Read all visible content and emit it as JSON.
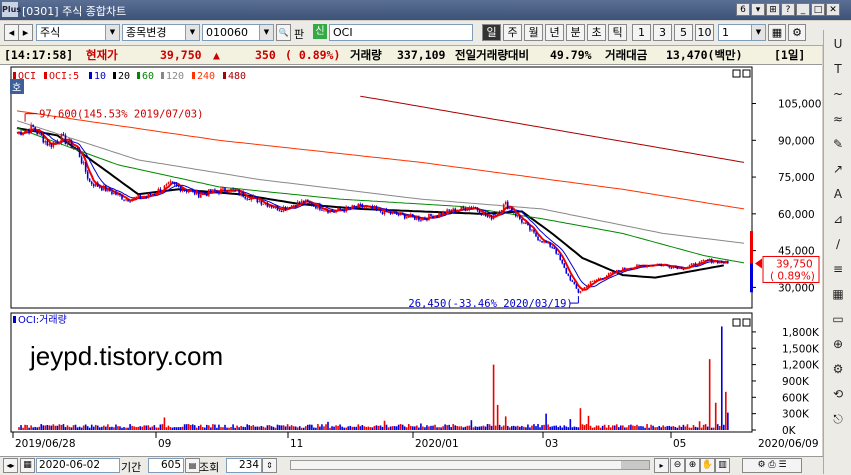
{
  "window": {
    "title": "[0301] 주식 종합차트",
    "logo": "Plus",
    "controls": [
      "6",
      "▾",
      "⊞",
      "?",
      "_",
      "□",
      "✕"
    ]
  },
  "toolbar": {
    "nav_prev": "◂",
    "nav_next": "▸",
    "market": "주식",
    "search_label": "종목변경",
    "code": "010060",
    "pan": "판",
    "sin": "신",
    "name": "OCI",
    "periods": [
      "일",
      "주",
      "월",
      "년",
      "분",
      "초",
      "틱"
    ],
    "active_period": "일",
    "intervals": [
      "1",
      "3",
      "5",
      "10"
    ],
    "interval_value": "1"
  },
  "pricebar": {
    "time": "[14:17:58]",
    "cur_label": "현재가",
    "price": "39,750",
    "arrow": "▲",
    "change": "350",
    "change_pct": "( 0.89%)",
    "vol_label": "거래량",
    "volume": "337,109",
    "prev_label": "전일거래량대비",
    "prev_ratio": "49.79%",
    "amount_label": "거래대금",
    "amount": "13,470(백만)",
    "period_tag": "[1일]"
  },
  "chart_data": {
    "type": "candlestick",
    "title": "",
    "legend": [
      {
        "label": "OCI",
        "color": "#cc0000"
      },
      {
        "label": "OCI:5",
        "color": "#dd0000"
      },
      {
        "label": "10",
        "color": "#0000cc"
      },
      {
        "label": "20",
        "color": "#000000"
      },
      {
        "label": "60",
        "color": "#008800"
      },
      {
        "label": "120",
        "color": "#888888"
      },
      {
        "label": "240",
        "color": "#ff3300"
      },
      {
        "label": "480",
        "color": "#aa0000"
      }
    ],
    "hoga_label": "호",
    "price_axis": {
      "ticks": [
        "105,000",
        "90,000",
        "75,000",
        "60,000",
        "45,000",
        "30,000"
      ],
      "ylim": [
        22000,
        115000
      ]
    },
    "date_axis": {
      "labels": [
        "2019/06/28",
        "09",
        "11",
        "2020/01",
        "03",
        "05"
      ],
      "end_label": "2020/06/09"
    },
    "annotations": {
      "high": "97,600(145.53% 2019/07/03)",
      "low": "26,450(-33.46% 2020/03/19)"
    },
    "current_price_label": "39,750",
    "current_change_label": "( 0.89%)",
    "volume_panel": {
      "title": "OCI:거래량",
      "ticks": [
        "1,800K",
        "1,500K",
        "1,200K",
        "900K",
        "600K",
        "300K",
        "0K"
      ],
      "ylim": [
        0,
        2000
      ]
    },
    "price_series_anchors": [
      [
        0,
        93000
      ],
      [
        8,
        95000
      ],
      [
        16,
        88000
      ],
      [
        22,
        91000
      ],
      [
        30,
        86000
      ],
      [
        36,
        73000
      ],
      [
        44,
        70000
      ],
      [
        54,
        66000
      ],
      [
        64,
        67000
      ],
      [
        76,
        72000
      ],
      [
        90,
        68000
      ],
      [
        105,
        70000
      ],
      [
        118,
        66000
      ],
      [
        130,
        62000
      ],
      [
        142,
        65000
      ],
      [
        156,
        61000
      ],
      [
        170,
        63000
      ],
      [
        186,
        60000
      ],
      [
        200,
        58000
      ],
      [
        214,
        61000
      ],
      [
        226,
        63000
      ],
      [
        234,
        58000
      ],
      [
        242,
        64000
      ],
      [
        250,
        57000
      ],
      [
        258,
        50000
      ],
      [
        266,
        46000
      ],
      [
        272,
        36000
      ],
      [
        278,
        28000
      ],
      [
        284,
        32000
      ],
      [
        292,
        35000
      ],
      [
        302,
        38000
      ],
      [
        316,
        39500
      ],
      [
        330,
        38000
      ],
      [
        342,
        41000
      ],
      [
        348,
        40500
      ],
      [
        352,
        39750
      ]
    ],
    "volume_spikes_k": [
      [
        73,
        230
      ],
      [
        154,
        150
      ],
      [
        182,
        170
      ],
      [
        200,
        120
      ],
      [
        225,
        180
      ],
      [
        236,
        1200
      ],
      [
        238,
        460
      ],
      [
        242,
        250
      ],
      [
        262,
        300
      ],
      [
        274,
        200
      ],
      [
        279,
        400
      ],
      [
        283,
        260
      ],
      [
        338,
        160
      ],
      [
        343,
        1300
      ],
      [
        346,
        500
      ],
      [
        349,
        1900
      ],
      [
        351,
        700
      ],
      [
        352,
        320
      ]
    ],
    "ma_anchor_prices": {
      "480": [
        [
          170,
          108000
        ],
        [
          360,
          81000
        ]
      ],
      "240": [
        [
          0,
          102000
        ],
        [
          100,
          90000
        ],
        [
          200,
          81000
        ],
        [
          300,
          70000
        ],
        [
          360,
          62000
        ]
      ],
      "120": [
        [
          0,
          98000
        ],
        [
          60,
          82000
        ],
        [
          120,
          74000
        ],
        [
          200,
          66000
        ],
        [
          260,
          62000
        ],
        [
          320,
          52000
        ],
        [
          360,
          48000
        ]
      ],
      "60": [
        [
          0,
          95000
        ],
        [
          50,
          80000
        ],
        [
          100,
          71000
        ],
        [
          160,
          66000
        ],
        [
          220,
          63000
        ],
        [
          260,
          58000
        ],
        [
          300,
          52000
        ],
        [
          340,
          43000
        ],
        [
          360,
          40000
        ]
      ],
      "20": [
        [
          0,
          95000
        ],
        [
          20,
          92000
        ],
        [
          40,
          80000
        ],
        [
          60,
          68000
        ],
        [
          80,
          70000
        ],
        [
          110,
          68000
        ],
        [
          140,
          64000
        ],
        [
          170,
          62000
        ],
        [
          200,
          61000
        ],
        [
          230,
          60000
        ],
        [
          250,
          61000
        ],
        [
          265,
          52000
        ],
        [
          280,
          42000
        ],
        [
          300,
          35000
        ],
        [
          316,
          34000
        ],
        [
          330,
          36000
        ],
        [
          350,
          39000
        ]
      ]
    }
  },
  "bottombar": {
    "date": "2020-06-02",
    "period_label": "기간",
    "period_value": "605",
    "view_label": "조회",
    "view_value": "234"
  },
  "sidebar": {
    "icons": [
      "U",
      "T",
      "~",
      "≈",
      "✎",
      "↗",
      "A",
      "⊿",
      "∕",
      "≡",
      "▦",
      "▭",
      "⊕",
      "⚙",
      "⟲",
      "⎋"
    ]
  }
}
